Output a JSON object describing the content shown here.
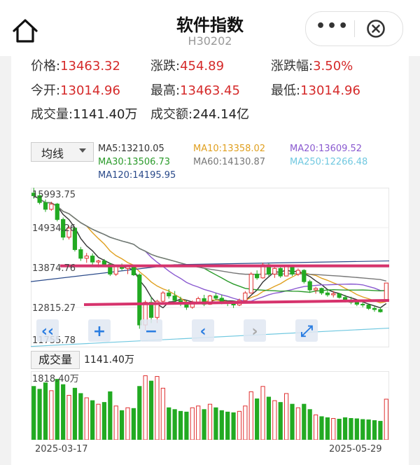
{
  "header": {
    "title": "软件指数",
    "subtitle": "H30202",
    "more_label": "•••"
  },
  "quote": {
    "price_label": "价格:",
    "price": "13463.32",
    "change_label": "涨跌:",
    "change": "454.89",
    "change_pct_label": "涨跌幅:",
    "change_pct": "3.50%",
    "open_label": "今开:",
    "open": "13014.96",
    "high_label": "最高:",
    "high": "13463.45",
    "low_label": "最低:",
    "low": "13014.96",
    "volume_label": "成交量:",
    "volume": "1141.40万",
    "amount_label": "成交额:",
    "amount": "244.14亿"
  },
  "chart_controls": {
    "indicator_select": "均线",
    "ma": [
      {
        "label": "MA5:13210.05",
        "color": "#333333"
      },
      {
        "label": "MA10:13358.02",
        "color": "#e0a020"
      },
      {
        "label": "MA20:13609.52",
        "color": "#8a5ad0"
      },
      {
        "label": "MA30:13506.73",
        "color": "#2a9a2a"
      },
      {
        "label": "MA60:14130.87",
        "color": "#777777"
      },
      {
        "label": "MA250:12266.48",
        "color": "#70c8e0"
      },
      {
        "label": "MA120:14195.95",
        "color": "#2a4a8a"
      }
    ]
  },
  "chart_data": {
    "type": "candlestick",
    "price_axis_labels": [
      "15993.75",
      "14934.26",
      "13874.76",
      "12815.27",
      "11755.78"
    ],
    "ylim": [
      11755.78,
      15993.75
    ],
    "volume_axis_label": "1818.40万",
    "volume_button": "成交量",
    "volume_value": "1141.40万",
    "x_start": "2025-03-17",
    "x_end": "2025-05-29",
    "up_color": "#e03030",
    "down_color": "#22aa22",
    "candles": [
      {
        "o": 15850,
        "h": 15990,
        "l": 15700,
        "c": 15780,
        "v": 1500
      },
      {
        "o": 15780,
        "h": 15840,
        "l": 15550,
        "c": 15600,
        "v": 1420
      },
      {
        "o": 15600,
        "h": 15680,
        "l": 15350,
        "c": 15420,
        "v": 1600
      },
      {
        "o": 15420,
        "h": 15620,
        "l": 15380,
        "c": 15560,
        "v": 1380
      },
      {
        "o": 15560,
        "h": 15590,
        "l": 15100,
        "c": 15150,
        "v": 1700
      },
      {
        "o": 15150,
        "h": 15200,
        "l": 14600,
        "c": 14680,
        "v": 1550
      },
      {
        "o": 14680,
        "h": 14980,
        "l": 14620,
        "c": 14920,
        "v": 1250
      },
      {
        "o": 14920,
        "h": 14950,
        "l": 14300,
        "c": 14350,
        "v": 1450
      },
      {
        "o": 14350,
        "h": 14420,
        "l": 14050,
        "c": 14120,
        "v": 1300
      },
      {
        "o": 14120,
        "h": 14260,
        "l": 14000,
        "c": 14180,
        "v": 1180
      },
      {
        "o": 14180,
        "h": 14250,
        "l": 13950,
        "c": 14020,
        "v": 1100
      },
      {
        "o": 14020,
        "h": 14080,
        "l": 13880,
        "c": 14050,
        "v": 1000
      },
      {
        "o": 14050,
        "h": 14100,
        "l": 13900,
        "c": 13960,
        "v": 1050
      },
      {
        "o": 13960,
        "h": 14000,
        "l": 13650,
        "c": 13700,
        "v": 1350
      },
      {
        "o": 13700,
        "h": 13950,
        "l": 13650,
        "c": 13920,
        "v": 950
      },
      {
        "o": 13920,
        "h": 13980,
        "l": 13800,
        "c": 13850,
        "v": 820
      },
      {
        "o": 13850,
        "h": 13950,
        "l": 13700,
        "c": 13900,
        "v": 900
      },
      {
        "o": 13900,
        "h": 13950,
        "l": 13650,
        "c": 13680,
        "v": 880
      },
      {
        "o": 13680,
        "h": 13720,
        "l": 12250,
        "c": 12350,
        "v": 1500
      },
      {
        "o": 12350,
        "h": 13000,
        "l": 12200,
        "c": 12950,
        "v": 1800
      },
      {
        "o": 12950,
        "h": 13100,
        "l": 12400,
        "c": 12550,
        "v": 1650
      },
      {
        "o": 12550,
        "h": 13020,
        "l": 12400,
        "c": 12980,
        "v": 1780
      },
      {
        "o": 12980,
        "h": 13250,
        "l": 12900,
        "c": 13200,
        "v": 1450
      },
      {
        "o": 13200,
        "h": 13300,
        "l": 13050,
        "c": 13120,
        "v": 900
      },
      {
        "o": 13120,
        "h": 13250,
        "l": 12950,
        "c": 13000,
        "v": 850
      },
      {
        "o": 13000,
        "h": 13100,
        "l": 12850,
        "c": 12900,
        "v": 800
      },
      {
        "o": 12900,
        "h": 13000,
        "l": 12750,
        "c": 12820,
        "v": 780
      },
      {
        "o": 12820,
        "h": 13000,
        "l": 12780,
        "c": 12960,
        "v": 900
      },
      {
        "o": 12960,
        "h": 13100,
        "l": 12900,
        "c": 13050,
        "v": 950
      },
      {
        "o": 13050,
        "h": 13150,
        "l": 12850,
        "c": 12900,
        "v": 850
      },
      {
        "o": 12900,
        "h": 13150,
        "l": 12880,
        "c": 13120,
        "v": 1000
      },
      {
        "o": 13120,
        "h": 13200,
        "l": 13000,
        "c": 13060,
        "v": 900
      },
      {
        "o": 13060,
        "h": 13150,
        "l": 12900,
        "c": 12950,
        "v": 820
      },
      {
        "o": 12950,
        "h": 13000,
        "l": 12850,
        "c": 12920,
        "v": 780
      },
      {
        "o": 12920,
        "h": 13000,
        "l": 12800,
        "c": 12880,
        "v": 760
      },
      {
        "o": 12880,
        "h": 13050,
        "l": 12850,
        "c": 13000,
        "v": 800
      },
      {
        "o": 13000,
        "h": 13250,
        "l": 12980,
        "c": 13200,
        "v": 950
      },
      {
        "o": 13200,
        "h": 13750,
        "l": 13180,
        "c": 13700,
        "v": 1350
      },
      {
        "o": 13700,
        "h": 13800,
        "l": 13550,
        "c": 13600,
        "v": 1150
      },
      {
        "o": 13600,
        "h": 14000,
        "l": 13580,
        "c": 13950,
        "v": 1500
      },
      {
        "o": 13950,
        "h": 13980,
        "l": 13650,
        "c": 13700,
        "v": 1200
      },
      {
        "o": 13700,
        "h": 13880,
        "l": 13600,
        "c": 13850,
        "v": 1100
      },
      {
        "o": 13850,
        "h": 13880,
        "l": 13600,
        "c": 13650,
        "v": 1050
      },
      {
        "o": 13650,
        "h": 13950,
        "l": 13640,
        "c": 13900,
        "v": 1300
      },
      {
        "o": 13900,
        "h": 13950,
        "l": 13650,
        "c": 13700,
        "v": 1000
      },
      {
        "o": 13700,
        "h": 13850,
        "l": 13650,
        "c": 13800,
        "v": 900
      },
      {
        "o": 13800,
        "h": 13830,
        "l": 13450,
        "c": 13500,
        "v": 1000
      },
      {
        "o": 13500,
        "h": 13550,
        "l": 13200,
        "c": 13280,
        "v": 850
      },
      {
        "o": 13280,
        "h": 13360,
        "l": 13180,
        "c": 13320,
        "v": 700
      },
      {
        "o": 13320,
        "h": 13340,
        "l": 13150,
        "c": 13200,
        "v": 650
      },
      {
        "o": 13200,
        "h": 13280,
        "l": 13100,
        "c": 13150,
        "v": 620
      },
      {
        "o": 13150,
        "h": 13250,
        "l": 13080,
        "c": 13180,
        "v": 600
      },
      {
        "o": 13180,
        "h": 13200,
        "l": 13050,
        "c": 13080,
        "v": 580
      },
      {
        "o": 13080,
        "h": 13150,
        "l": 12950,
        "c": 13000,
        "v": 620
      },
      {
        "o": 13000,
        "h": 13100,
        "l": 12900,
        "c": 12950,
        "v": 600
      },
      {
        "o": 12950,
        "h": 13000,
        "l": 12850,
        "c": 12900,
        "v": 590
      },
      {
        "o": 12900,
        "h": 12950,
        "l": 12820,
        "c": 12880,
        "v": 570
      },
      {
        "o": 12880,
        "h": 12900,
        "l": 12750,
        "c": 12790,
        "v": 560
      },
      {
        "o": 12790,
        "h": 12850,
        "l": 12700,
        "c": 12760,
        "v": 540
      },
      {
        "o": 12760,
        "h": 12820,
        "l": 12680,
        "c": 12700,
        "v": 520
      },
      {
        "o": 13014.96,
        "h": 13463.45,
        "l": 13014.96,
        "c": 13463.32,
        "v": 1141.4
      }
    ]
  },
  "nav": {
    "prev_fast": "‹‹",
    "zoom_in": "+",
    "zoom_out": "−",
    "prev": "‹",
    "next": "›",
    "expand": "⤢"
  }
}
